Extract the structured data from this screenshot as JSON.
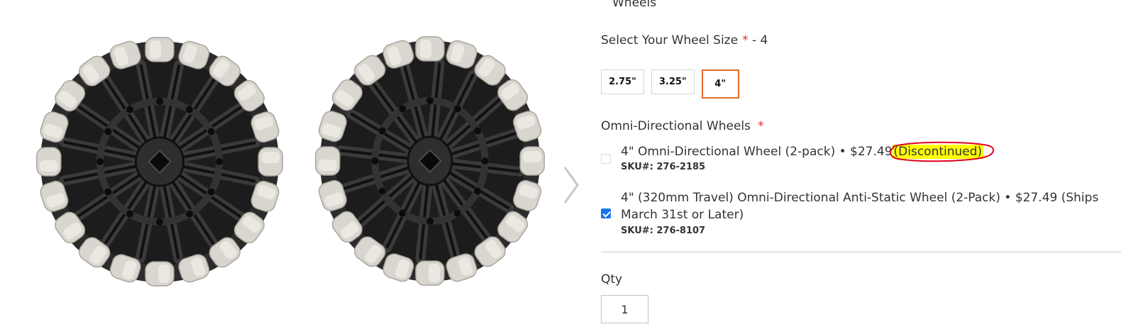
{
  "header_cut_text": "Wheels",
  "wheel_size": {
    "label": "Select Your Wheel Size",
    "required_mark": "*",
    "selected_display": " - 4",
    "options": [
      {
        "label": "2.75\"",
        "selected": false
      },
      {
        "label": "3.25\"",
        "selected": false
      },
      {
        "label": "4\"",
        "selected": true
      }
    ]
  },
  "omni_wheels": {
    "label": "Omni-Directional Wheels",
    "required_mark": "*",
    "items": [
      {
        "checked": false,
        "name": "4\" Omni-Directional Wheel (2-pack) • $27.49",
        "status": "(Discontinued)",
        "sku": "SKU#: 276-2185"
      },
      {
        "checked": true,
        "name": "4\" (320mm Travel) Omni-Directional Anti-Static Wheel (2-Pack) • $27.49 (Ships March 31st or Later)",
        "sku": "SKU#: 276-8107"
      }
    ]
  },
  "qty": {
    "label": "Qty",
    "value": "1"
  },
  "colors": {
    "accent": "#e36c2c",
    "required": "#e02b27",
    "highlight": "#ffff00",
    "annotation": "#e0001b",
    "checkbox": "#1a73e8"
  },
  "icons": {
    "gallery_next": "chevron-right-icon"
  }
}
